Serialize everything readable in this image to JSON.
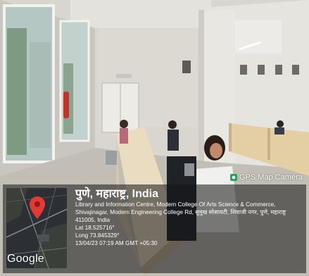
{
  "photo": {
    "description_icon": "library-reading-room-photo"
  },
  "watermark": {
    "label": "GPS Map Camera",
    "icon": "gps-camera-icon"
  },
  "geotag": {
    "place": "पुणे, महाराष्ट्र, India",
    "address_line1": "Library and Information Centre, Modern College Of Arts Science & Commerce,",
    "address_line2": "Shivajinagar, Modern Engineering College Rd, सुमुख सोसायटी, शिवाजी नगर, पुणे, महाराष्ट्र",
    "address_line3": "411005, India",
    "lat": "Lat 18.525716°",
    "long": "Long 73.845329°",
    "timestamp": "13/04/23 07:19 AM GMT +05:30",
    "map_brand": "Google",
    "pin_icon": "map-pin-icon"
  }
}
